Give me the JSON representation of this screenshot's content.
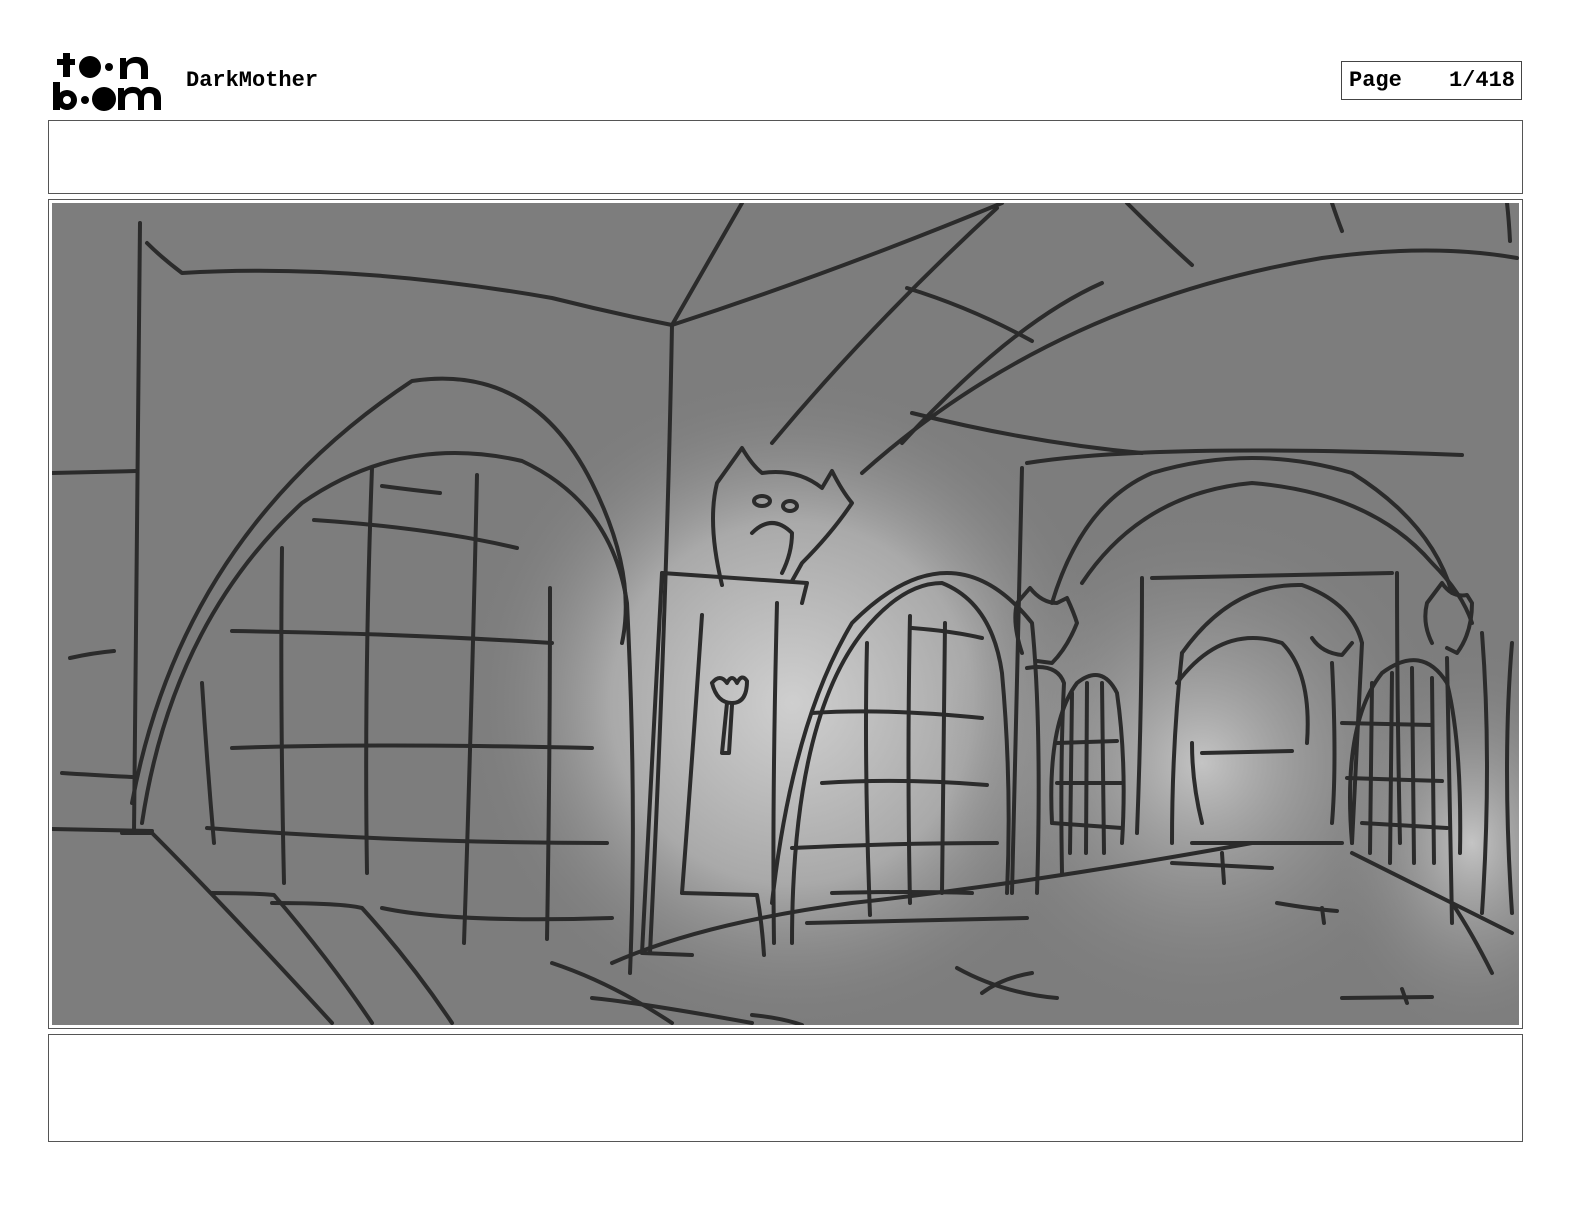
{
  "header": {
    "logo_text": "toon boom",
    "project_title": "DarkMother",
    "page_label": "Page",
    "page_number": "1/418"
  },
  "panel": {
    "top_notes": "",
    "image_icon": "storyboard-sketch-castle-corridor",
    "bottom_notes": ""
  },
  "colors": {
    "sketch_background": "#7d7d7d",
    "sketch_line": "#2b2b2b",
    "glow": "#c8c8c8"
  }
}
